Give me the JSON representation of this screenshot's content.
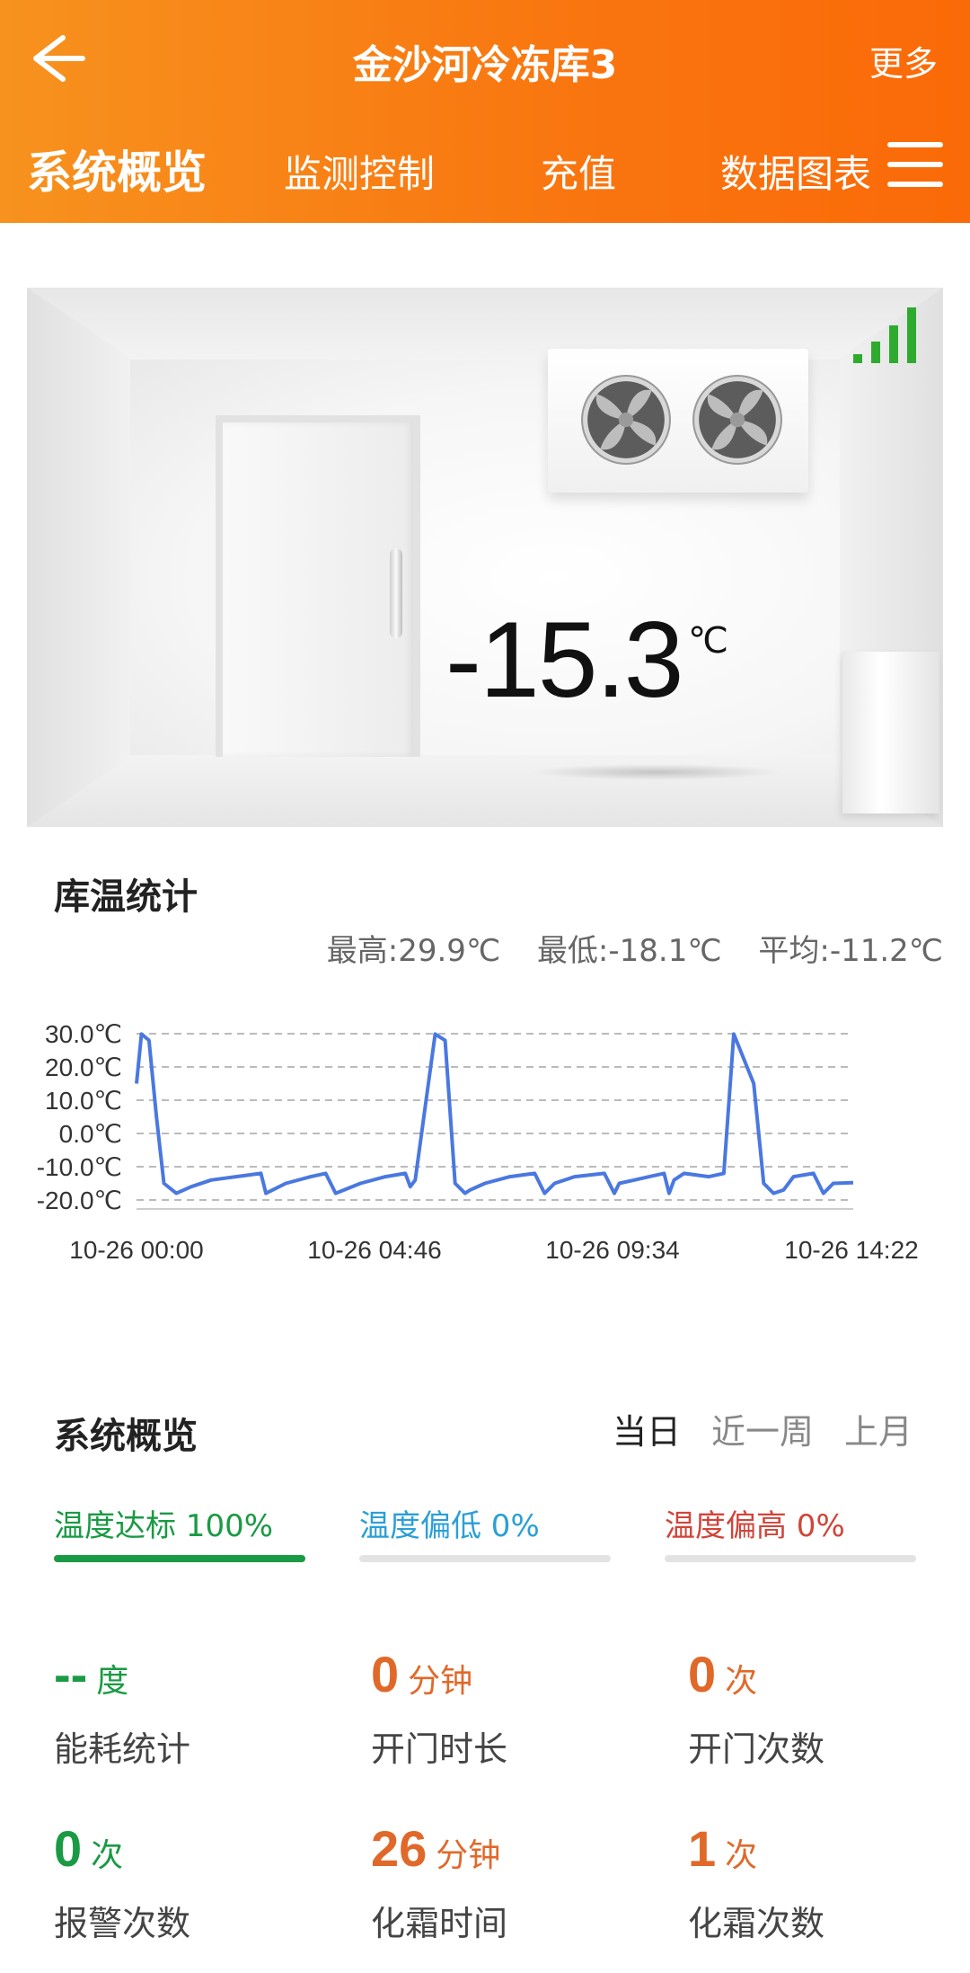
{
  "header": {
    "title": "金沙河冷冻库3",
    "more_label": "更多",
    "tabs": [
      "系统概览",
      "监测控制",
      "充值",
      "数据图表"
    ]
  },
  "scene": {
    "temperature": "-15.3",
    "unit": "℃",
    "signal_icon": "signal-bars-icon",
    "signal_color": "#2eab2e"
  },
  "stats": {
    "title": "库温统计",
    "max": "最高:29.9℃",
    "min": "最低:-18.1℃",
    "avg": "平均:-11.2℃"
  },
  "chart_data": {
    "type": "line",
    "y_ticks": [
      "30.0℃",
      "20.0℃",
      "10.0℃",
      "0.0℃",
      "-10.0℃",
      "-20.0℃"
    ],
    "x_ticks": [
      "10-26 00:00",
      "10-26 04:46",
      "10-26 09:34",
      "10-26 14:22"
    ],
    "ylim": [
      -20,
      30
    ],
    "grid": true,
    "line_color": "#4a78e0",
    "x_hours": [
      0,
      0.1,
      0.25,
      0.4,
      0.55,
      0.8,
      1.1,
      1.5,
      2.0,
      2.5,
      2.6,
      3.0,
      3.5,
      3.8,
      4.0,
      4.5,
      5.0,
      5.4,
      5.5,
      5.6,
      6.0,
      6.2,
      6.4,
      6.6,
      6.7,
      7.0,
      7.5,
      8.0,
      8.2,
      8.4,
      8.8,
      9.4,
      9.6,
      9.7,
      10.0,
      10.3,
      10.6,
      10.7,
      10.8,
      11.0,
      11.5,
      11.8,
      12.0,
      12.4,
      12.6,
      12.8,
      13.0,
      13.2,
      13.6,
      13.8,
      14.0,
      14.4
    ],
    "values": [
      15,
      29.9,
      28,
      5,
      -15,
      -18,
      -16,
      -14,
      -13,
      -12,
      -18,
      -15,
      -13,
      -12,
      -18,
      -15,
      -13,
      -12,
      -16,
      -14,
      29.9,
      28,
      -15,
      -18,
      -17,
      -15,
      -13,
      -12,
      -18,
      -15,
      -13,
      -12,
      -18,
      -15,
      -14,
      -13,
      -12,
      -18,
      -14,
      -12,
      -13,
      -12,
      29.9,
      15,
      -15,
      -18,
      -17,
      -13,
      -12,
      -18,
      -15,
      -14.8
    ]
  },
  "overview": {
    "title": "系统概览",
    "periods": [
      "当日",
      "近一周",
      "上月"
    ],
    "compliance": [
      {
        "label": "温度达标 100%",
        "color": "#1a9a44",
        "fill": 1.0
      },
      {
        "label": "温度偏低 0%",
        "color": "#2b9fd6",
        "fill": 0
      },
      {
        "label": "温度偏高 0%",
        "color": "#d0453a",
        "fill": 0
      }
    ],
    "metrics": [
      {
        "num": "--",
        "unit": "度",
        "label": "能耗统计",
        "color": "#1a9a44"
      },
      {
        "num": "0",
        "unit": "分钟",
        "label": "开门时长",
        "color": "#e0692a"
      },
      {
        "num": "0",
        "unit": "次",
        "label": "开门次数",
        "color": "#e0692a"
      },
      {
        "num": "0",
        "unit": "次",
        "label": "报警次数",
        "color": "#1a9a44"
      },
      {
        "num": "26",
        "unit": "分钟",
        "label": "化霜时间",
        "color": "#e0692a"
      },
      {
        "num": "1",
        "unit": "次",
        "label": "化霜次数",
        "color": "#e0692a"
      }
    ]
  }
}
